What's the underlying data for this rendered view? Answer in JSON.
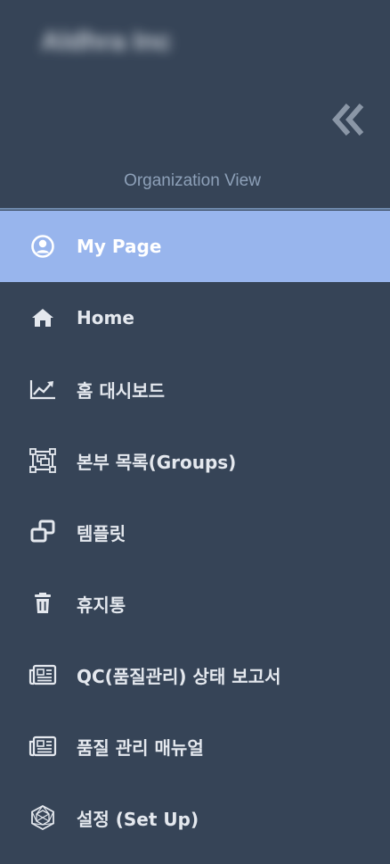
{
  "sidebar": {
    "org_name": "Aldhra Inc",
    "view_label": "Organization View",
    "collapse_icon": "double-chevron-left-icon",
    "active_bg": "#98b5ed",
    "background": "#364457",
    "items": [
      {
        "label": "My Page",
        "icon": "user-circle-icon",
        "active": true
      },
      {
        "label": "Home",
        "icon": "home-icon"
      },
      {
        "label": "홈 대시보드",
        "icon": "line-chart-icon"
      },
      {
        "label": "본부 목록(Groups)",
        "icon": "group-select-icon"
      },
      {
        "label": "템플릿",
        "icon": "clone-icon"
      },
      {
        "label": "휴지통",
        "icon": "trash-icon"
      },
      {
        "label": "QC(품질관리) 상태 보고서",
        "icon": "newspaper-icon"
      },
      {
        "label": "품질 관리 매뉴얼",
        "icon": "newspaper-icon"
      },
      {
        "label": "설정 (Set Up)",
        "icon": "hexagon-mesh-icon"
      }
    ]
  }
}
